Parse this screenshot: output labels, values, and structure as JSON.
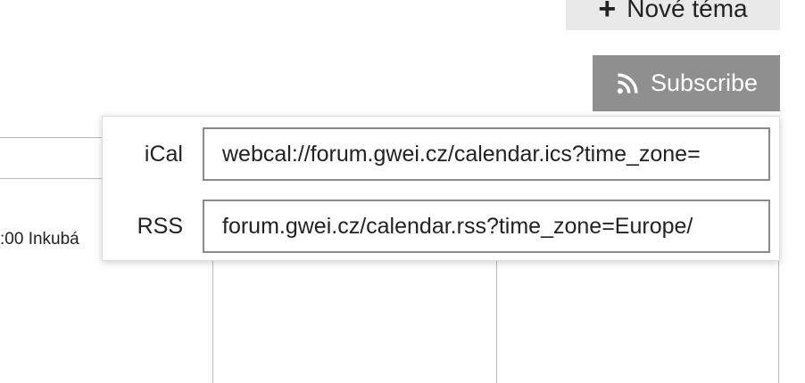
{
  "header": {
    "new_topic_label": "Nové téma",
    "subscribe_label": "Subscribe"
  },
  "calendar": {
    "event_text": ":00 Inkubá"
  },
  "subscribe_popup": {
    "ical_label": "iCal",
    "ical_url": "webcal://forum.gwei.cz/calendar.ics?time_zone=",
    "rss_label": "RSS",
    "rss_url": "forum.gwei.cz/calendar.rss?time_zone=Europe/"
  },
  "colors": {
    "subscribe_bg": "#8f8f8f",
    "new_topic_bg": "#e9e9e9"
  }
}
